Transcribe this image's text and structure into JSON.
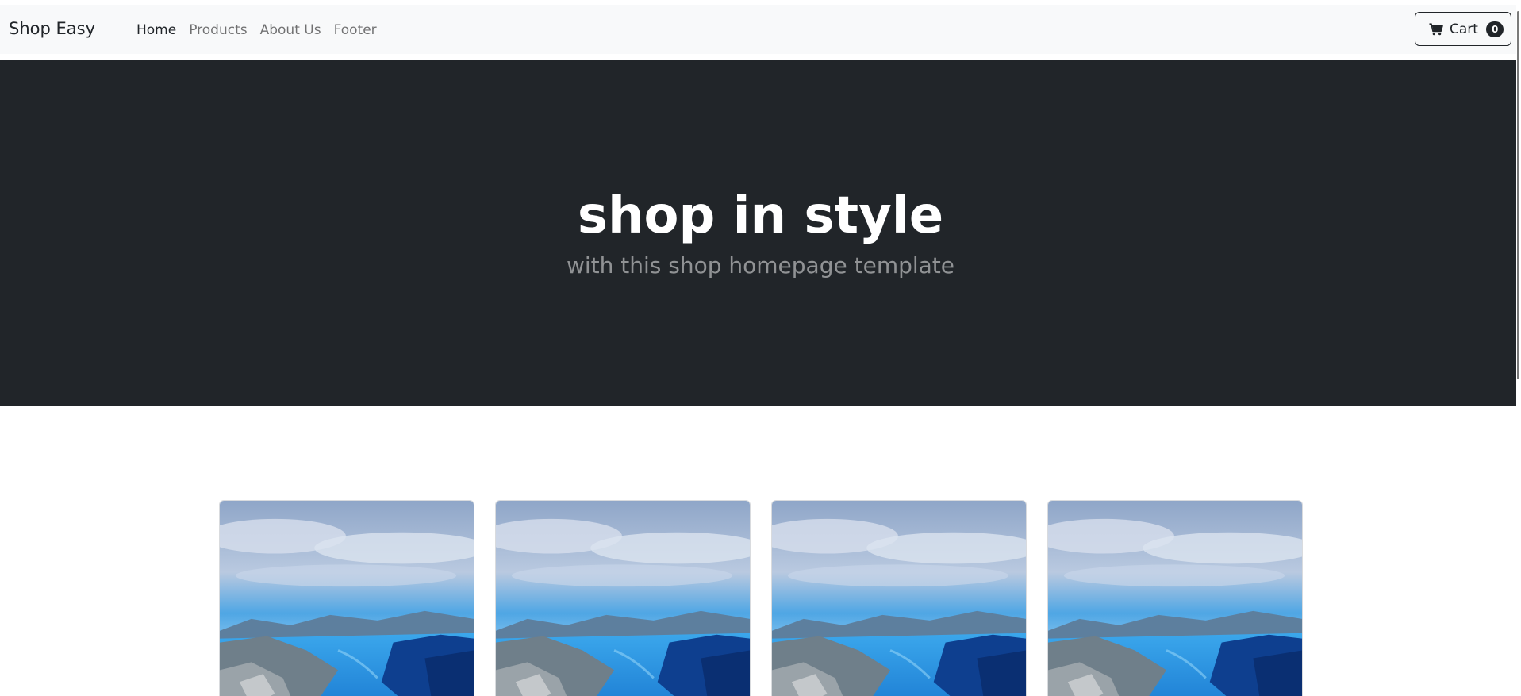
{
  "brand": "Shop Easy",
  "nav": {
    "items": [
      {
        "label": "Home",
        "active": true
      },
      {
        "label": "Products",
        "active": false
      },
      {
        "label": "About Us",
        "active": false
      },
      {
        "label": "Footer",
        "active": false
      }
    ]
  },
  "cart": {
    "label": "Cart",
    "count": "0",
    "icon": "cart-icon"
  },
  "hero": {
    "title": "shop in style",
    "subtitle": "with this shop homepage template"
  },
  "products": [
    {
      "image": "fjord-landscape"
    },
    {
      "image": "fjord-landscape"
    },
    {
      "image": "fjord-landscape"
    },
    {
      "image": "fjord-landscape"
    }
  ],
  "colors": {
    "navbar_bg": "#f8f9fa",
    "hero_bg": "#212529",
    "text_dark": "#212529"
  }
}
